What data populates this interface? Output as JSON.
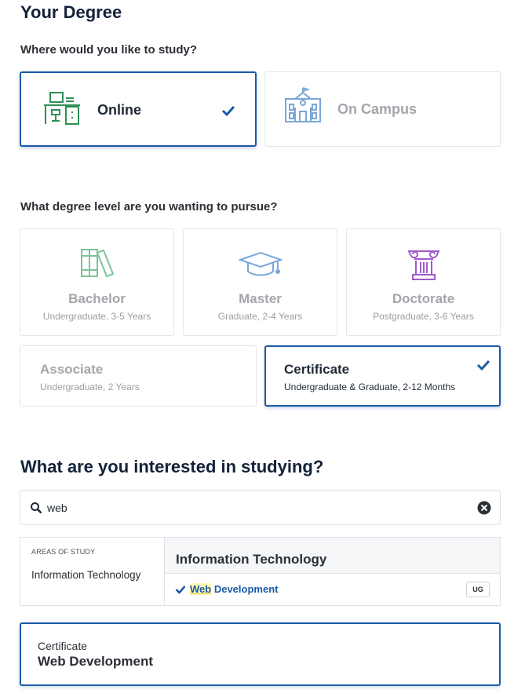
{
  "header": {
    "title": "Your Degree"
  },
  "study_mode": {
    "question": "Where would you like to study?",
    "options": [
      {
        "label": "Online",
        "selected": true,
        "icon": "desk-computer-icon"
      },
      {
        "label": "On Campus",
        "selected": false,
        "icon": "campus-building-icon"
      }
    ]
  },
  "degree_level": {
    "question": "What degree level are you wanting to pursue?",
    "options": [
      {
        "label": "Bachelor",
        "sub": "Undergraduate, 3-5 Years",
        "icon": "books-icon",
        "selected": false
      },
      {
        "label": "Master",
        "sub": "Graduate, 2-4 Years",
        "icon": "graduation-cap-icon",
        "selected": false
      },
      {
        "label": "Doctorate",
        "sub": "Postgraduate, 3-6 Years",
        "icon": "column-icon",
        "selected": false
      },
      {
        "label": "Associate",
        "sub": "Undergraduate, 2 Years",
        "selected": false
      },
      {
        "label": "Certificate",
        "sub": "Undergraduate & Graduate, 2-12 Months",
        "selected": true
      }
    ]
  },
  "interest": {
    "question": "What are you interested in studying?",
    "search_value": "web",
    "areas_label": "AREAS OF STUDY",
    "areas": [
      "Information Technology"
    ],
    "group_title": "Information Technology",
    "result": {
      "highlight": "Web",
      "rest": " Development",
      "badge": "UG"
    }
  },
  "selection": {
    "level": "Certificate",
    "program": "Web Development"
  },
  "colors": {
    "accent": "#1b5aa6",
    "green": "#2f8f55",
    "blue_icon": "#7aa6d9",
    "purple_icon": "#a05bc9"
  }
}
